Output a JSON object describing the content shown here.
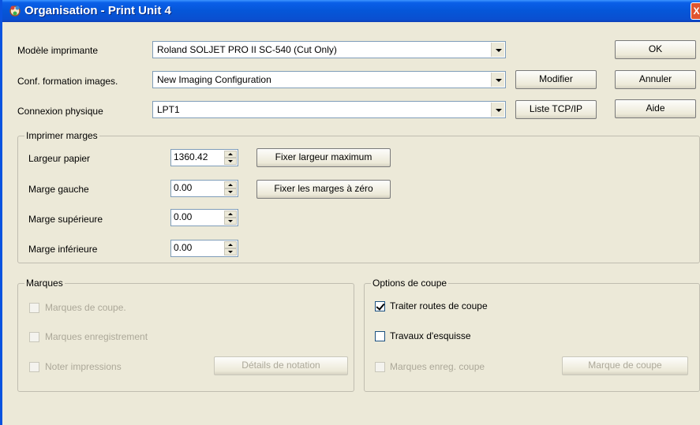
{
  "window": {
    "title": "Organisation - Print Unit 4",
    "close_label": "X"
  },
  "fields": {
    "printer_model": {
      "label": "Modèle imprimante",
      "value": "Roland  SOLJET PRO II SC-540 (Cut Only)"
    },
    "imaging_config": {
      "label": "Conf. formation images.",
      "value": "New Imaging Configuration"
    },
    "connection": {
      "label": "Connexion physique",
      "value": "LPT1"
    }
  },
  "buttons": {
    "ok": "OK",
    "cancel": "Annuler",
    "help": "Aide",
    "modify": "Modifier",
    "tcpip": "Liste TCP/IP",
    "max_width": "Fixer largeur maximum",
    "zero_margins": "Fixer les marges à zéro",
    "notation_details": "Détails de notation",
    "cut_mark": "Marque de coupe"
  },
  "margins": {
    "title": "Imprimer marges",
    "paper_width": {
      "label": "Largeur papier",
      "value": "1360.42"
    },
    "left": {
      "label": "Marge gauche",
      "value": "0.00"
    },
    "top": {
      "label": "Marge supérieure",
      "value": "0.00"
    },
    "bottom": {
      "label": "Marge inférieure",
      "value": "0.00"
    }
  },
  "marks": {
    "title": "Marques",
    "cut_marks": {
      "label": "Marques de coupe.",
      "checked": false,
      "enabled": false
    },
    "registration": {
      "label": "Marques enregistrement",
      "checked": false,
      "enabled": false
    },
    "note_prints": {
      "label": "Noter impressions",
      "checked": false,
      "enabled": false
    }
  },
  "cut_options": {
    "title": "Options de coupe",
    "process_paths": {
      "label": "Traiter routes de coupe",
      "checked": true,
      "enabled": true
    },
    "sketch_jobs": {
      "label": "Travaux d'esquisse",
      "checked": false,
      "enabled": true
    },
    "cut_reg_marks": {
      "label": "Marques enreg. coupe",
      "checked": false,
      "enabled": false
    }
  },
  "colors": {
    "titlebar": "#0a5fe8",
    "face": "#ece9d8",
    "disabled_text": "#aca899"
  }
}
